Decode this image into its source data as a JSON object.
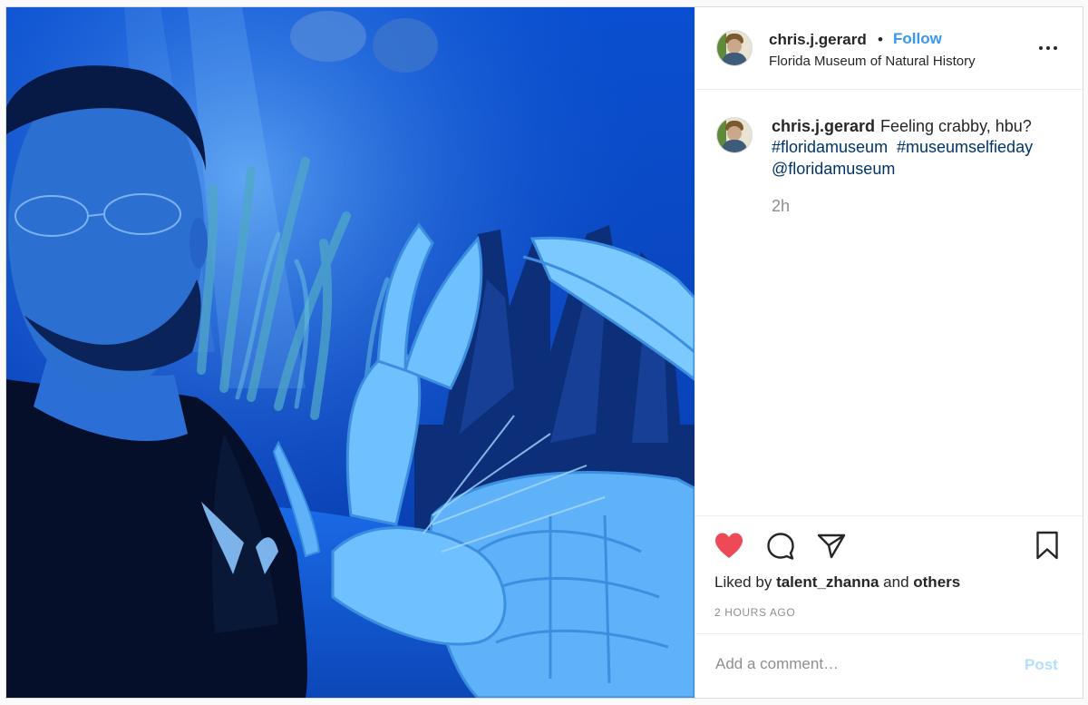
{
  "header": {
    "username": "chris.j.gerard",
    "separator": "•",
    "follow_label": "Follow",
    "location": "Florida Museum of Natural History"
  },
  "caption": {
    "username": "chris.j.gerard",
    "text": "Feeling crabby, hbu?",
    "hashtag_1": "#floridamuseum",
    "hashtag_2": "#museumselfieday",
    "mention": "@floridamuseum",
    "time": "2h"
  },
  "likes": {
    "prefix": "Liked by",
    "user": "talent_zhanna",
    "and": "and",
    "others": "others"
  },
  "timestamp": "2 HOURS AGO",
  "comment": {
    "placeholder": "Add a comment…",
    "post_label": "Post"
  },
  "icons": {
    "more": "more-options-icon",
    "like": "heart-icon",
    "comment": "comment-icon",
    "share": "share-icon",
    "save": "bookmark-icon"
  },
  "colors": {
    "like_active": "#ed4956",
    "link_blue": "#3897f0",
    "hashtag": "#003569",
    "post_disabled": "#b2dffc",
    "photo_tint": "#0a4fd0"
  }
}
